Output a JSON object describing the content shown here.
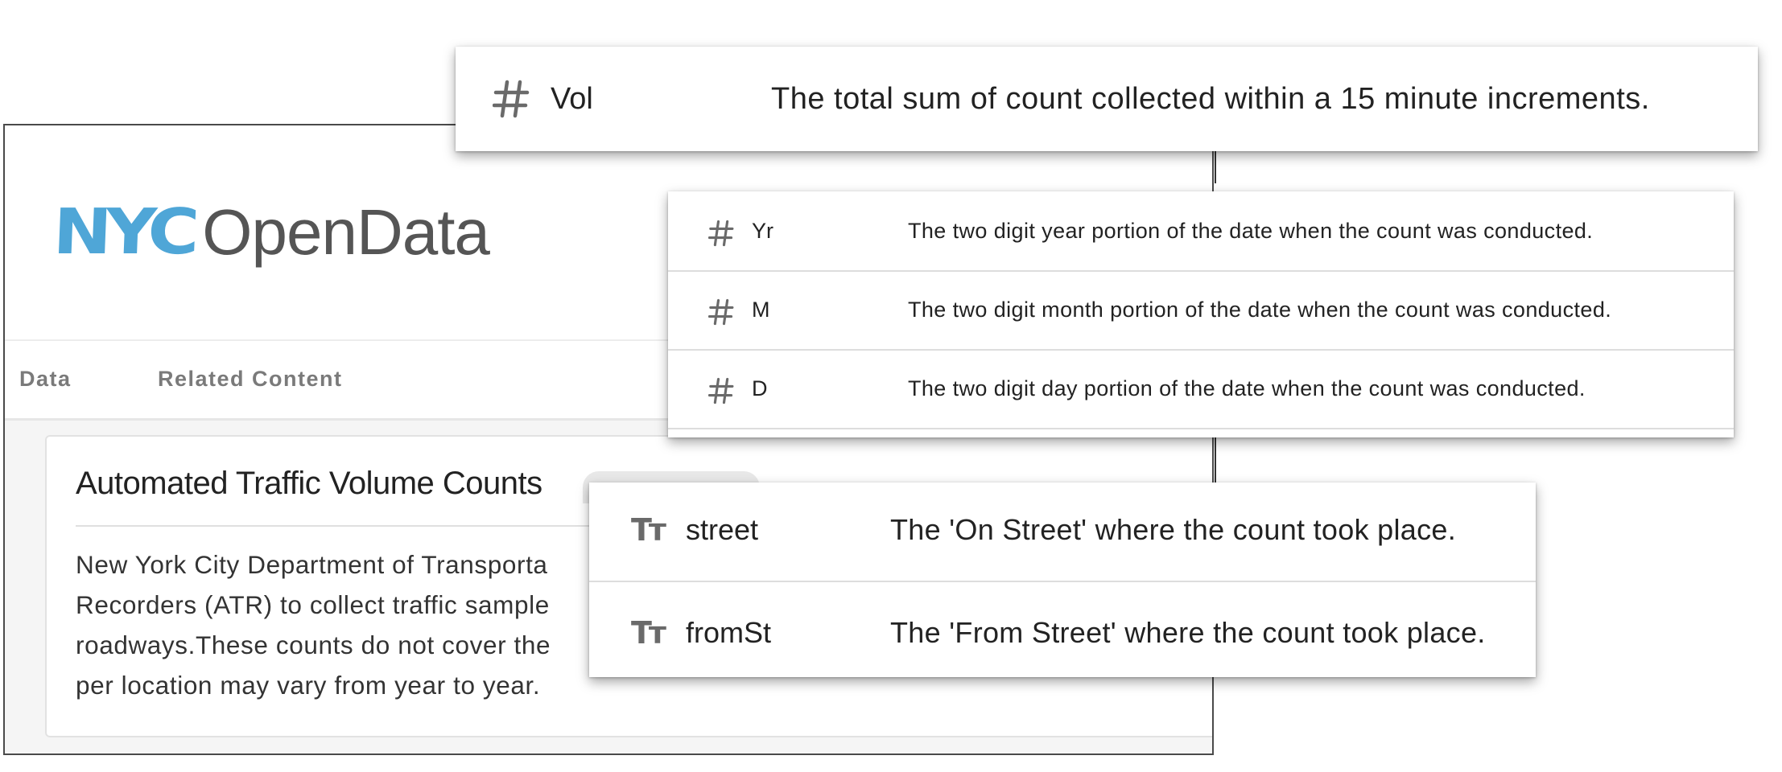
{
  "logo": {
    "nyc": "NYC",
    "open_data": "OpenData",
    "brand_blue": "#4fa6d7",
    "brand_gray": "#555555"
  },
  "nav": {
    "tabs": [
      {
        "label": "Data"
      },
      {
        "label": "Related Content"
      }
    ]
  },
  "dataset": {
    "title": "Automated Traffic Volume Counts",
    "description_lines": [
      "New York City Department of Transporta",
      "Recorders (ATR) to collect traffic sample",
      "roadways.These counts do not cover the",
      "per location may vary from year to year."
    ]
  },
  "columns": {
    "vol": {
      "type_icon": "number-hash-icon",
      "name": "Vol",
      "description": "The total sum of count collected within a 15 minute increments."
    },
    "date_parts": [
      {
        "type_icon": "number-hash-icon",
        "name": "Yr",
        "description": "The two digit year portion of the date when the count was conducted."
      },
      {
        "type_icon": "number-hash-icon",
        "name": "M",
        "description": "The two digit month portion of the date when the count was conducted."
      },
      {
        "type_icon": "number-hash-icon",
        "name": "D",
        "description": "The two digit day portion of the date when the count was conducted."
      }
    ],
    "streets": [
      {
        "type_icon": "text-type-icon",
        "type_glyph": "Tт",
        "name": "street",
        "description": "The 'On Street' where the count took place."
      },
      {
        "type_icon": "text-type-icon",
        "type_glyph": "Tт",
        "name": "fromSt",
        "description": "The 'From Street' where the count took place."
      }
    ]
  }
}
